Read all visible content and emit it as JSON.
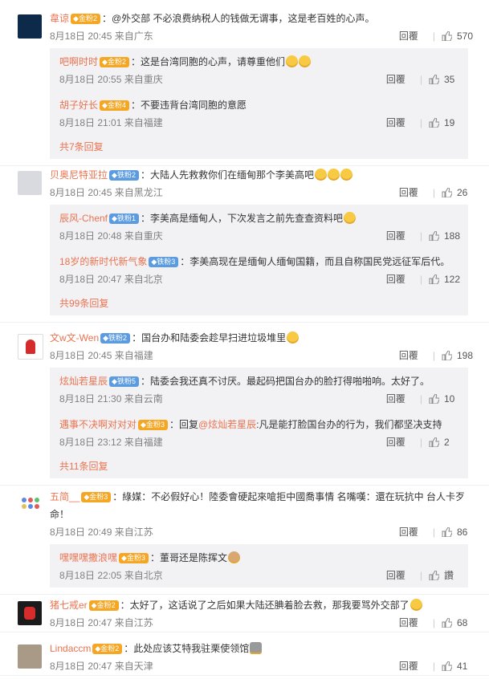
{
  "comments": [
    {
      "name": "韋谅",
      "badge": "金粉2",
      "badge_type": "gold",
      "text": "：@外交部 不必浪费纳税人的钱做无谓事，这是老百姓的心声。",
      "time": "8月18日 20:45 来自广东",
      "reply": "回覆",
      "likes": "570",
      "subs": [
        {
          "name": "吧啊时时",
          "badge": "金粉2",
          "badge_type": "gold",
          "text": "：这是台湾同胞的心声，请尊重他们",
          "time": "8月18日 20:55 来自重庆",
          "reply": "回覆",
          "likes": "35"
        },
        {
          "name": "胡子好长",
          "badge": "金粉4",
          "badge_type": "gold",
          "text": "：不要违背台湾同胞的意愿",
          "time": "8月18日 21:01 来自福建",
          "reply": "回覆",
          "likes": "19"
        }
      ],
      "more": "共7条回复"
    },
    {
      "name": "贝奥尼特亚拉",
      "badge": "铁粉2",
      "badge_type": "iron",
      "text": "：大陆人先救救你们在缅甸那个李美高吧",
      "time": "8月18日 20:45 来自黑龙江",
      "reply": "回覆",
      "likes": "26",
      "subs": [
        {
          "name": "辰风-Chenf",
          "badge": "铁粉1",
          "badge_type": "iron",
          "text": "：李美高是缅甸人，下次发言之前先查查资料吧",
          "time": "8月18日 20:48 来自重庆",
          "reply": "回覆",
          "likes": "188"
        },
        {
          "name": "18岁的新时代新气象",
          "badge": "铁粉3",
          "badge_type": "iron",
          "text": "：李美高现在是缅甸人缅甸国籍，而且自称国民党远征军后代。",
          "time": "8月18日 20:47 来自北京",
          "reply": "回覆",
          "likes": "122"
        }
      ],
      "more": "共99条回复"
    },
    {
      "name": "文w文-Wen",
      "badge": "铁粉2",
      "badge_type": "iron",
      "text": "：国台办和陆委会趁早扫进垃圾堆里",
      "time": "8月18日 20:45 来自福建",
      "reply": "回覆",
      "likes": "198",
      "subs": [
        {
          "name": "炫灿若星辰",
          "badge": "铁粉5",
          "badge_type": "iron",
          "text": "：陆委会我还真不讨厌。最起码把国台办的脸打得啪啪响。太好了。",
          "time": "8月18日 21:30 来自云南",
          "reply": "回覆",
          "likes": "10"
        },
        {
          "name": "遇事不决啊对对对",
          "badge": "金粉3",
          "badge_type": "gold",
          "text_pre": "：回复",
          "link": "@炫灿若星辰",
          "text": ":凡是能打脸国台办的行为，我们都坚决支持",
          "time": "8月18日 23:12 来自福建",
          "reply": "回覆",
          "likes": "2"
        }
      ],
      "more": "共11条回复"
    },
    {
      "name": "五简__",
      "badge": "金粉3",
      "badge_type": "gold",
      "text": "：綠媒：不必假好心！陸委會硬起來嗆拒中國喬事情 名嘴嘆：還在玩抗中 台人卡歹命！",
      "time": "8月18日 20:49 来自江苏",
      "reply": "回覆",
      "likes": "86",
      "subs": [
        {
          "name": "嘿嘿嘿撒浪嘿",
          "badge": "金粉3",
          "badge_type": "gold",
          "text": "：董哥还是陈挥文",
          "time": "8月18日 22:05 来自北京",
          "reply": "回覆",
          "likes": "讚"
        }
      ],
      "more": ""
    },
    {
      "name": "猪七戒er",
      "badge": "金粉2",
      "badge_type": "gold",
      "text": "：太好了，这话说了之后如果大陆还腆着脸去救，那我要骂外交部了",
      "time": "8月18日 20:47 来自江苏",
      "reply": "回覆",
      "likes": "68",
      "subs": [],
      "more": ""
    },
    {
      "name": "Lindaccm",
      "badge": "金粉2",
      "badge_type": "gold",
      "text": "：此处应该艾特我驻栗使领馆",
      "time": "8月18日 20:47 来自天津",
      "reply": "回覆",
      "likes": "41",
      "subs": [],
      "more": ""
    }
  ],
  "colors": {
    "accent": "#eb7350",
    "gold_badge": "#f5a623",
    "iron_badge": "#5b9be0",
    "sub_bg": "#f2f2f5"
  }
}
